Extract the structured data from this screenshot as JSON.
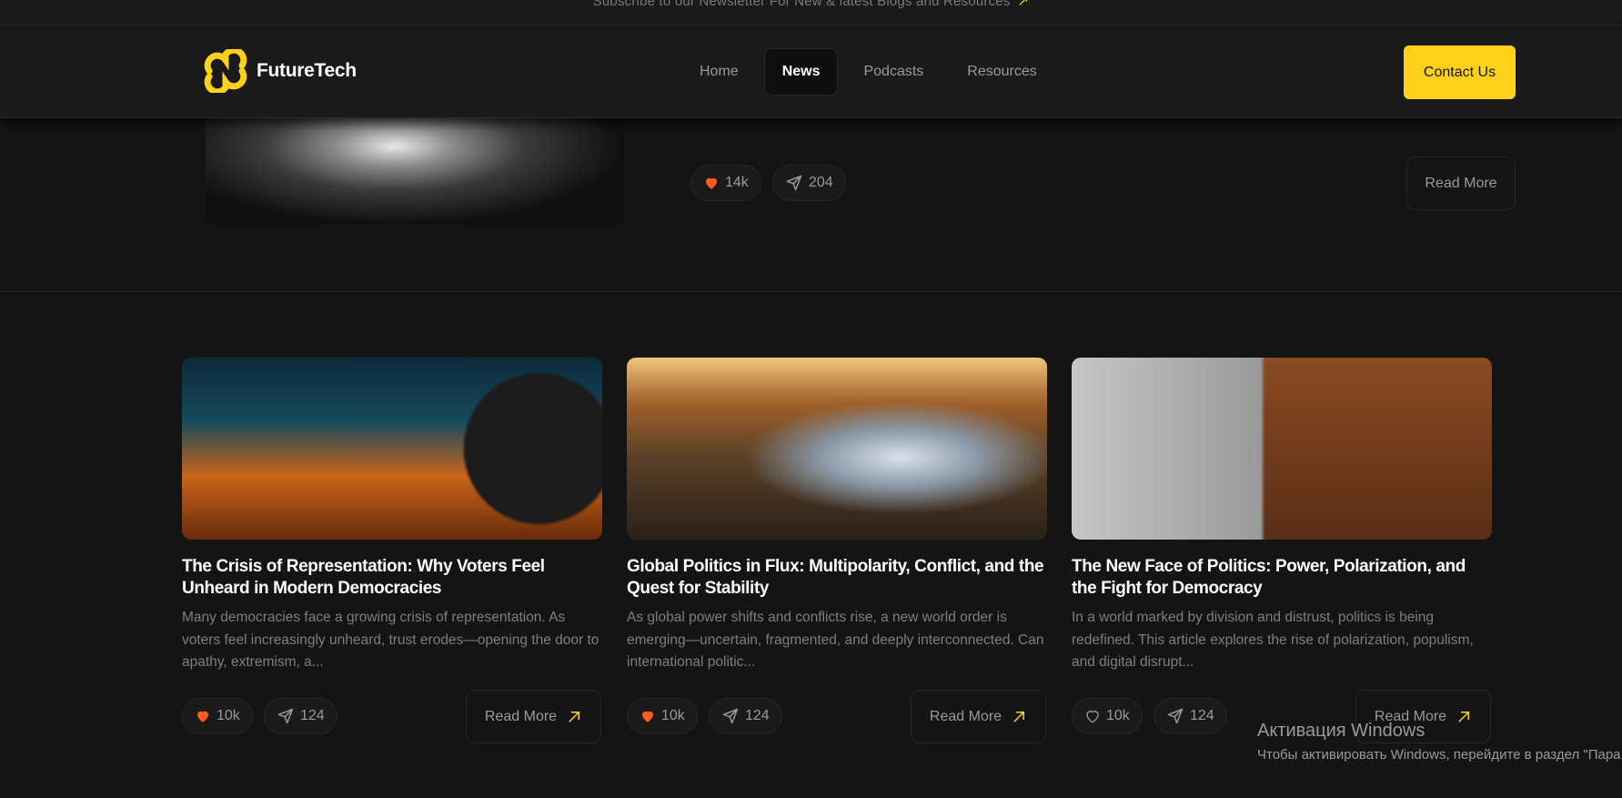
{
  "topbar": {
    "text": "Subscribe to our Newsletter For New & latest Blogs and Resources",
    "arrow": "↗"
  },
  "brand": {
    "name": "FutureTech",
    "accent": "#ffd11a"
  },
  "nav": {
    "items": [
      {
        "label": "Home",
        "active": false
      },
      {
        "label": "News",
        "active": true
      },
      {
        "label": "Podcasts",
        "active": false
      },
      {
        "label": "Resources",
        "active": false
      }
    ]
  },
  "contact_label": "Contact Us",
  "previous_article": {
    "likes": "14k",
    "shares": "204",
    "read_more": "Read More"
  },
  "cards": [
    {
      "title": "The Crisis of Representation: Why Voters Feel Unheard in Modern Democracies",
      "desc": "Many democracies face a growing crisis of representation. As voters feel increasingly unheard, trust erodes—opening the door to apathy, extremism, a...",
      "likes": "10k",
      "shares": "124",
      "liked": true,
      "read_more": "Read More"
    },
    {
      "title": "Global Politics in Flux: Multipolarity, Conflict, and the Quest for Stability",
      "desc": "As global power shifts and conflicts rise, a new world order is emerging—uncertain, fragmented, and deeply interconnected. Can international politic...",
      "likes": "10k",
      "shares": "124",
      "liked": true,
      "read_more": "Read More"
    },
    {
      "title": "The New Face of Politics: Power, Polarization, and the Fight for Democracy",
      "desc": "In a world marked by division and distrust, politics is being redefined. This article explores the rise of polarization, populism, and digital disrupt...",
      "likes": "10k",
      "shares": "124",
      "liked": false,
      "read_more": "Read More"
    }
  ],
  "colors": {
    "like": "#ff5a1f",
    "background": "#141414",
    "border": "#262626"
  },
  "watermark": {
    "line1": "Активация Windows",
    "line2": "Чтобы активировать Windows, перейдите в раздел \"Пара"
  }
}
